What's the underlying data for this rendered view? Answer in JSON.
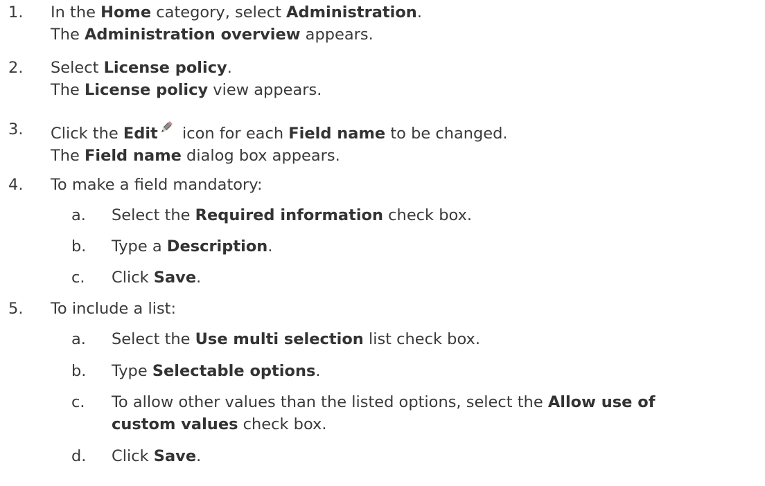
{
  "steps": [
    {
      "num": "1.",
      "l1": [
        "In the ",
        "Home",
        " category, select ",
        "Administration",
        "."
      ],
      "l2": [
        "The ",
        "Administration overview",
        " appears."
      ]
    },
    {
      "num": "2.",
      "l1": [
        "Select ",
        "License policy",
        "."
      ],
      "l2": [
        "The ",
        "License policy",
        " view appears."
      ]
    },
    {
      "num": "3.",
      "l1": [
        "Click the ",
        "Edit",
        " icon for each ",
        "Field name",
        " to be changed."
      ],
      "l2": [
        "The ",
        "Field name",
        " dialog box appears."
      ]
    },
    {
      "num": "4.",
      "l1": [
        "To make a field mandatory:"
      ],
      "subs": [
        {
          "letter": "a.",
          "parts": [
            "Select the ",
            "Required information",
            " check box."
          ]
        },
        {
          "letter": "b.",
          "parts": [
            "Type a ",
            "Description",
            "."
          ]
        },
        {
          "letter": "c.",
          "parts": [
            "Click ",
            "Save",
            "."
          ]
        }
      ]
    },
    {
      "num": "5.",
      "l1": [
        "To include a list:"
      ],
      "subs": [
        {
          "letter": "a.",
          "parts": [
            "Select the ",
            "Use multi selection",
            " list check box."
          ]
        },
        {
          "letter": "b.",
          "parts": [
            "Type ",
            "Selectable options",
            "."
          ]
        },
        {
          "letter": "c.",
          "parts": [
            "To allow other values than the listed options, select the ",
            "Allow use of"
          ],
          "parts2": [
            "custom values",
            " check box."
          ]
        },
        {
          "letter": "d.",
          "parts": [
            "Click ",
            "Save",
            "."
          ]
        }
      ]
    }
  ],
  "icons": {
    "edit": "pencil-icon"
  }
}
